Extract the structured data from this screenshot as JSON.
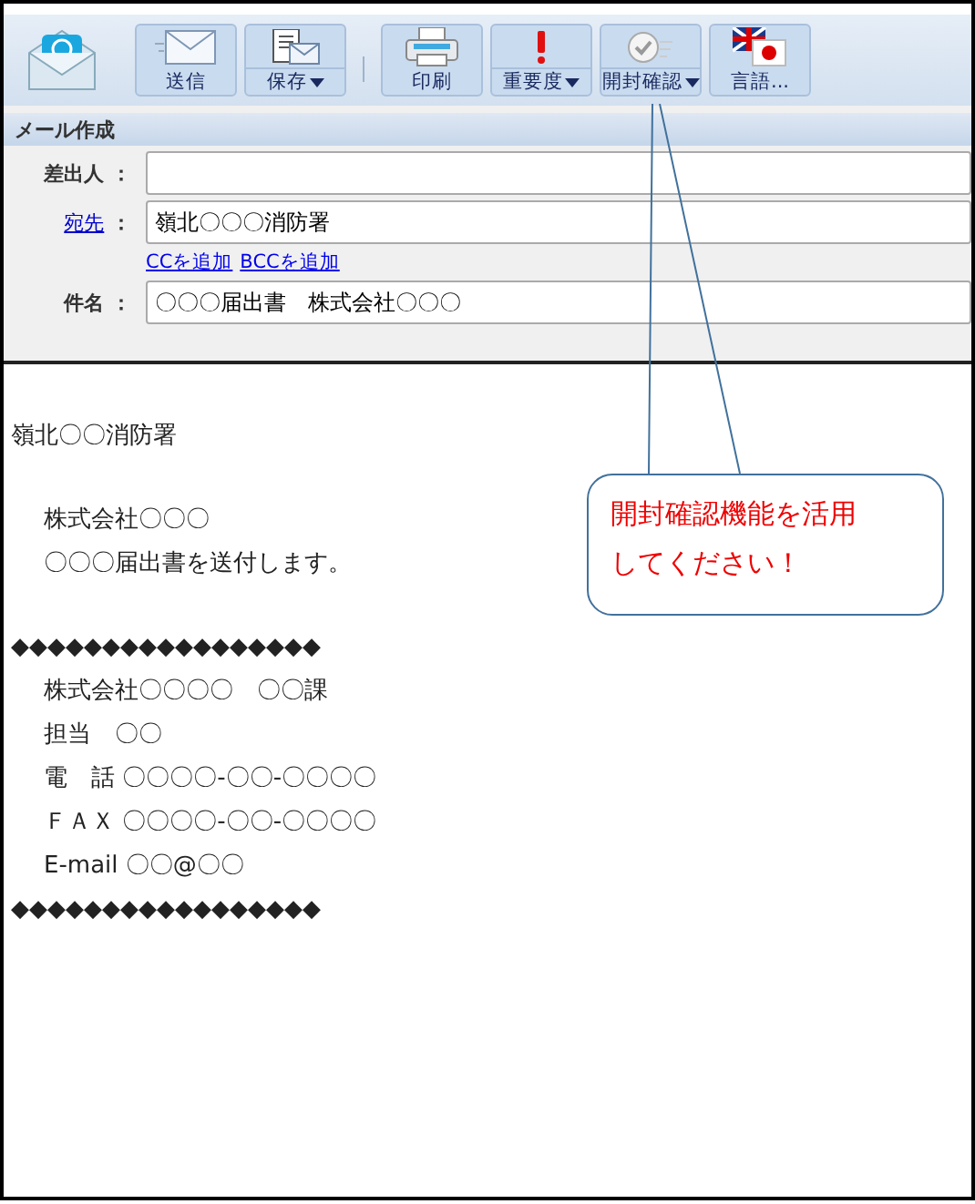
{
  "toolbar": {
    "buttons": [
      {
        "kind": "send",
        "label": "送信",
        "menu": false
      },
      {
        "kind": "save",
        "label": "保存",
        "menu": true
      },
      {
        "kind": "print",
        "label": "印刷",
        "menu": false
      },
      {
        "kind": "priority",
        "label": "重要度",
        "menu": true
      },
      {
        "kind": "receipt",
        "label": "開封確認",
        "menu": true
      },
      {
        "kind": "language",
        "label": "言語...",
        "menu": false
      }
    ]
  },
  "compose": {
    "title": "メール作成",
    "fields": [
      {
        "kind": "plain",
        "label": "差出人",
        "separator": "："
      },
      {
        "kind": "link",
        "label": "宛先",
        "separator": "：",
        "value": "嶺北〇〇〇消防署"
      },
      {
        "kind": "links",
        "links": [
          "CCを追加",
          "BCCを追加"
        ]
      },
      {
        "kind": "plain",
        "label": "件名",
        "separator": "：",
        "value": "〇〇〇届出書　株式会社〇〇〇"
      }
    ]
  },
  "body": {
    "paragraphs": [
      {
        "lines": [
          {
            "text": "嶺北〇〇消防署",
            "indent": false
          }
        ]
      },
      {
        "lines": [
          {
            "text": "株式会社〇〇〇",
            "indent": true
          },
          {
            "text": "〇〇〇届出書を送付します。",
            "indent": true
          }
        ]
      },
      {
        "lines": [
          {
            "text": "◆◆◆◆◆◆◆◆◆◆◆◆◆◆◆◆◆",
            "indent": false
          },
          {
            "text": "株式会社〇〇〇〇　〇〇課",
            "indent": true
          },
          {
            "text": "担当　〇〇",
            "indent": true
          },
          {
            "text": "電　話 〇〇〇〇-〇〇-〇〇〇〇",
            "indent": true
          },
          {
            "text": "ＦＡＸ 〇〇〇〇-〇〇-〇〇〇〇",
            "indent": true
          },
          {
            "text": "E-mail 〇〇@〇〇",
            "indent": true
          },
          {
            "text": "◆◆◆◆◆◆◆◆◆◆◆◆◆◆◆◆◆",
            "indent": false
          }
        ]
      }
    ]
  },
  "callout": {
    "lines": [
      "開封確認機能を活用",
      "してください！"
    ]
  }
}
